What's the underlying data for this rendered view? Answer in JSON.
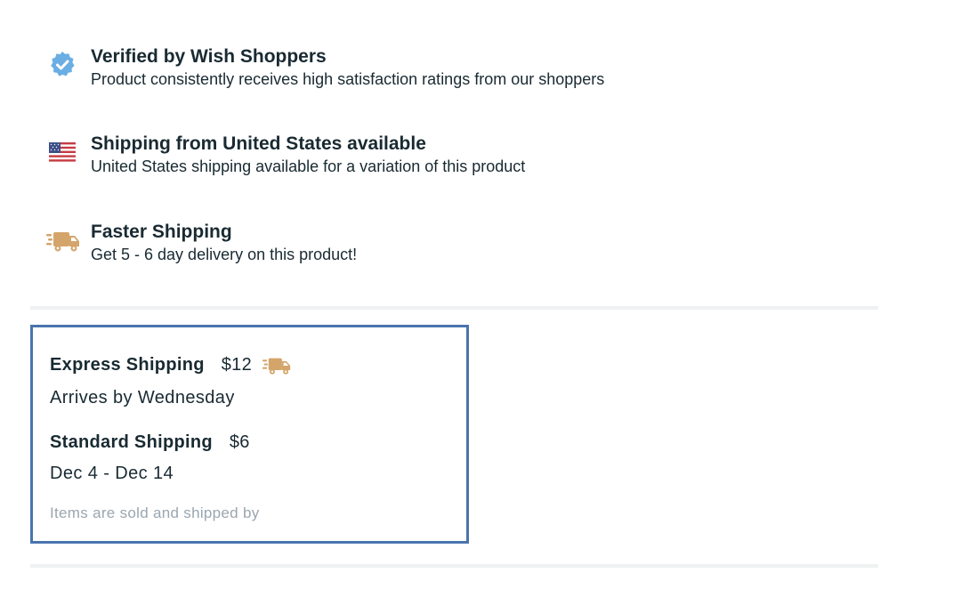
{
  "features": [
    {
      "icon": "verified-badge-icon",
      "title": "Verified by Wish Shoppers",
      "description": "Product consistently receives high satisfaction ratings from our shoppers"
    },
    {
      "icon": "us-flag-icon",
      "title": "Shipping from United States available",
      "description": "United States shipping available for a variation of this product"
    },
    {
      "icon": "fast-truck-icon",
      "title": "Faster Shipping",
      "description": "Get 5 - 6 day delivery on this product!"
    }
  ],
  "shipping": {
    "express": {
      "name": "Express Shipping",
      "price": "$12",
      "icon": "fast-truck-icon",
      "arrival": "Arrives by Wednesday"
    },
    "standard": {
      "name": "Standard Shipping",
      "price": "$6",
      "arrival": "Dec 4 - Dec 14"
    },
    "sold_by": "Items are sold and shipped by"
  },
  "colors": {
    "text": "#192a32",
    "muted": "#9aa6b0",
    "highlight_border": "#4a74ae",
    "verified_blue": "#6aaee3",
    "truck_tan": "#d4a56a",
    "divider": "#eff1f2"
  }
}
